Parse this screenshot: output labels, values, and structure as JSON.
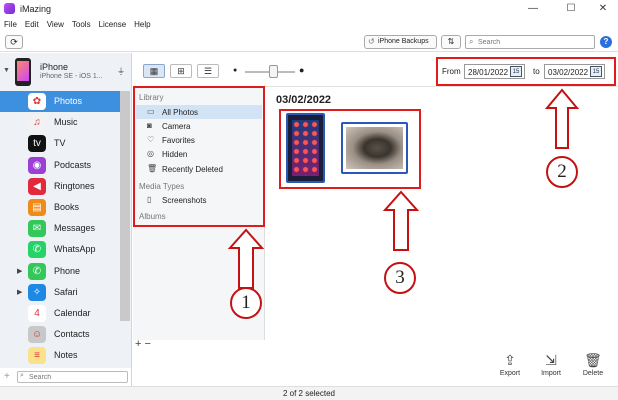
{
  "window": {
    "title": "iMazing",
    "minimize": "—",
    "maximize": "☐",
    "close": "✕"
  },
  "menu": [
    "File",
    "Edit",
    "View",
    "Tools",
    "License",
    "Help"
  ],
  "toolbar": {
    "refresh_icon": "⟳",
    "backups_label": "iPhone Backups",
    "backups_icon": "clock-back-icon",
    "transfer_icon": "⇅",
    "search_placeholder": "Search",
    "help_label": "?"
  },
  "device": {
    "name": "iPhone",
    "subtitle": "iPhone SE - iOS 1...",
    "usb_icon": "usb-icon"
  },
  "apps": [
    {
      "label": "Photos",
      "icon": "photos-icon",
      "glyph": "✿",
      "color": "#ffffff",
      "selected": true
    },
    {
      "label": "Music",
      "icon": "music-icon",
      "glyph": "♫",
      "color": "#f2f2f2"
    },
    {
      "label": "TV",
      "icon": "tv-icon",
      "glyph": "tv",
      "color": "#111111"
    },
    {
      "label": "Podcasts",
      "icon": "podcasts-icon",
      "glyph": "◉",
      "color": "#9b3fd6"
    },
    {
      "label": "Ringtones",
      "icon": "ringtones-icon",
      "glyph": "◀",
      "color": "#e22a3c"
    },
    {
      "label": "Books",
      "icon": "books-icon",
      "glyph": "▤",
      "color": "#f08a18"
    },
    {
      "label": "Messages",
      "icon": "messages-icon",
      "glyph": "✉",
      "color": "#34c759"
    },
    {
      "label": "WhatsApp",
      "icon": "whatsapp-icon",
      "glyph": "✆",
      "color": "#25d366"
    },
    {
      "label": "Phone",
      "icon": "phone-icon",
      "glyph": "✆",
      "color": "#34c759",
      "expandable": true
    },
    {
      "label": "Safari",
      "icon": "safari-icon",
      "glyph": "✧",
      "color": "#1e88e5",
      "expandable": true
    },
    {
      "label": "Calendar",
      "icon": "calendar-icon",
      "glyph": "4",
      "color": "#ffffff"
    },
    {
      "label": "Contacts",
      "icon": "contacts-icon",
      "glyph": "☺",
      "color": "#c8c8c8"
    },
    {
      "label": "Notes",
      "icon": "notes-icon",
      "glyph": "≡",
      "color": "#fbe28a"
    }
  ],
  "sidebar_search_placeholder": "Search",
  "sidebar_add": "+",
  "date_filter": {
    "from_label": "From",
    "from_value": "28/01/2022",
    "to_label": "to",
    "to_value": "03/02/2022",
    "calendar_glyph": "15"
  },
  "library": {
    "section_library": "Library",
    "items": [
      {
        "label": "All Photos",
        "icon": "photo-icon",
        "glyph": "▭",
        "selected": true
      },
      {
        "label": "Camera",
        "icon": "camera-icon",
        "glyph": "◙"
      },
      {
        "label": "Favorites",
        "icon": "heart-icon",
        "glyph": "♡"
      },
      {
        "label": "Hidden",
        "icon": "eye-off-icon",
        "glyph": "◎"
      },
      {
        "label": "Recently Deleted",
        "icon": "trash-icon",
        "glyph": "🗑"
      }
    ],
    "section_media": "Media Types",
    "media_items": [
      {
        "label": "Screenshots",
        "icon": "screenshot-icon",
        "glyph": "▯"
      }
    ],
    "section_albums": "Albums",
    "add_remove": "+ −"
  },
  "content": {
    "date_heading": "03/02/2022"
  },
  "annotations": [
    "1",
    "2",
    "3"
  ],
  "actions": [
    {
      "label": "Export",
      "icon": "export-icon",
      "glyph": "⇪"
    },
    {
      "label": "Import",
      "icon": "import-icon",
      "glyph": "⇲"
    },
    {
      "label": "Delete",
      "icon": "trash-icon",
      "glyph": "🗑"
    }
  ],
  "status": "2 of 2 selected",
  "colors": {
    "selection": "#3d8fe0",
    "annotation_red": "#e01b1b",
    "thumb_border": "#2a58b5"
  }
}
